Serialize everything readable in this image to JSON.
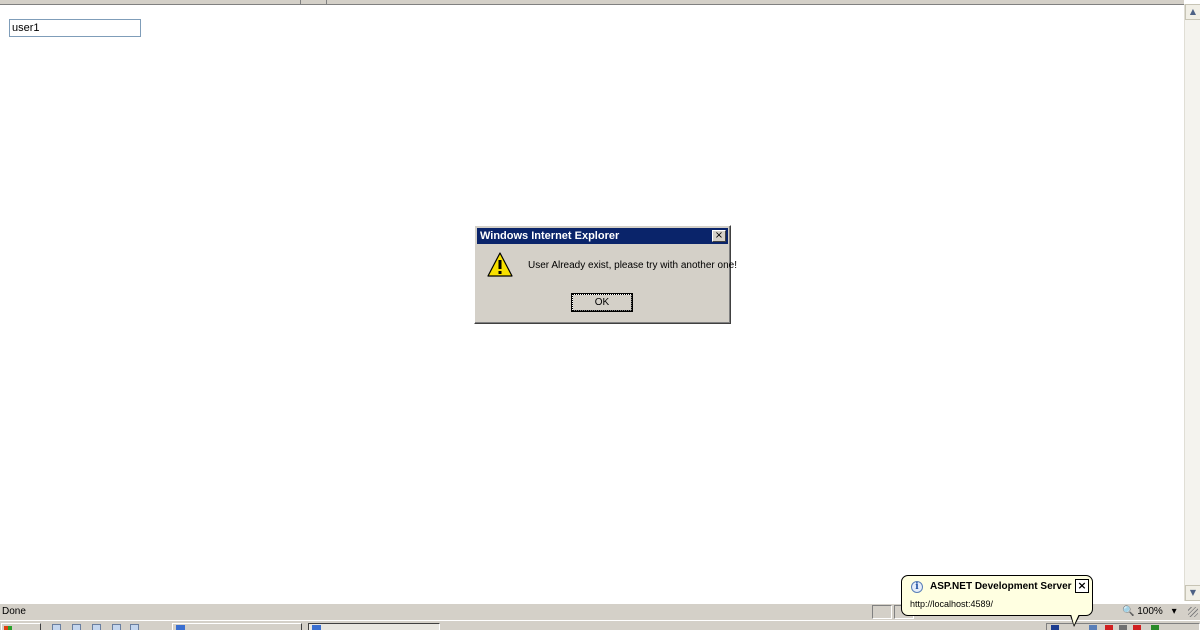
{
  "page": {
    "username_value": "user1"
  },
  "dialog": {
    "title": "Windows Internet Explorer",
    "close_glyph": "×",
    "icon": "warning-icon",
    "message": "User Already exist, please try with another one!",
    "ok_label": "OK"
  },
  "statusbar": {
    "status_text": "Done",
    "zoom_label": "100%",
    "zoom_icon": "zoom-icon"
  },
  "balloon": {
    "icon": "info-icon",
    "title": "ASP.NET Development Server",
    "body": "http://localhost:4589/",
    "close_glyph": "×"
  },
  "colors": {
    "titlebar": "#0a246a",
    "chrome": "#d4d0c8",
    "balloon_bg": "#ffffe1"
  }
}
